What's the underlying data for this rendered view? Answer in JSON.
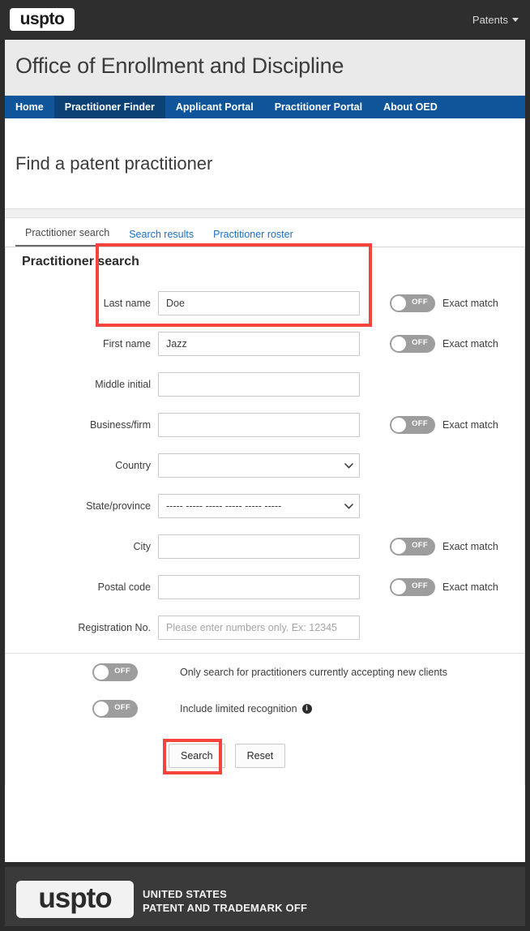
{
  "topbar": {
    "logo_text": "uspto",
    "menu_label": "Patents"
  },
  "site": {
    "title": "Office of Enrollment and Discipline"
  },
  "mainnav": {
    "items": [
      {
        "label": "Home",
        "active": false
      },
      {
        "label": "Practitioner Finder",
        "active": true
      },
      {
        "label": "Applicant Portal",
        "active": false
      },
      {
        "label": "Practitioner Portal",
        "active": false
      },
      {
        "label": "About OED",
        "active": false
      }
    ]
  },
  "page": {
    "heading": "Find a patent practitioner"
  },
  "tabs": [
    {
      "label": "Practitioner search",
      "active": true
    },
    {
      "label": "Search results",
      "active": false
    },
    {
      "label": "Practitioner roster",
      "active": false
    }
  ],
  "form": {
    "section_title": "Practitioner search",
    "exact_match_label": "Exact match",
    "toggle_off_text": "OFF",
    "fields": [
      {
        "label": "Last name",
        "type": "text",
        "value": "Doe",
        "placeholder": "",
        "exact_match": true,
        "exact_match_state": "OFF"
      },
      {
        "label": "First name",
        "type": "text",
        "value": "Jazz",
        "placeholder": "",
        "exact_match": true,
        "exact_match_state": "OFF"
      },
      {
        "label": "Middle initial",
        "type": "text",
        "value": "",
        "placeholder": "",
        "exact_match": false
      },
      {
        "label": "Business/firm",
        "type": "text",
        "value": "",
        "placeholder": "",
        "exact_match": true,
        "exact_match_state": "OFF"
      },
      {
        "label": "Country",
        "type": "select",
        "value": "",
        "options": [
          ""
        ],
        "exact_match": false
      },
      {
        "label": "State/province",
        "type": "select",
        "value": "----- ----- ----- ----- ----- -----",
        "options": [
          "----- ----- ----- ----- ----- -----"
        ],
        "exact_match": false
      },
      {
        "label": "City",
        "type": "text",
        "value": "",
        "placeholder": "",
        "exact_match": true,
        "exact_match_state": "OFF"
      },
      {
        "label": "Postal code",
        "type": "text",
        "value": "",
        "placeholder": "",
        "exact_match": true,
        "exact_match_state": "OFF"
      },
      {
        "label": "Registration No.",
        "type": "text",
        "value": "",
        "placeholder": "Please enter numbers only. Ex: 12345",
        "exact_match": false
      }
    ],
    "options": [
      {
        "label": "Only search for practitioners currently accepting new clients",
        "state": "OFF",
        "info": false
      },
      {
        "label": "Include limited recognition",
        "state": "OFF",
        "info": true
      }
    ],
    "buttons": {
      "search_label": "Search",
      "reset_label": "Reset"
    }
  },
  "footer": {
    "logo_text": "uspto",
    "line1": "UNITED STATES",
    "line2": "PATENT AND TRADEMARK OFF"
  },
  "colors": {
    "nav_blue": "#10559a",
    "nav_blue_active": "#0b4175",
    "link_blue": "#1a6fc4",
    "highlight_red": "#f4443c",
    "toggle_grey": "#9d9d9d",
    "chrome_dark": "#2e2e2e"
  }
}
